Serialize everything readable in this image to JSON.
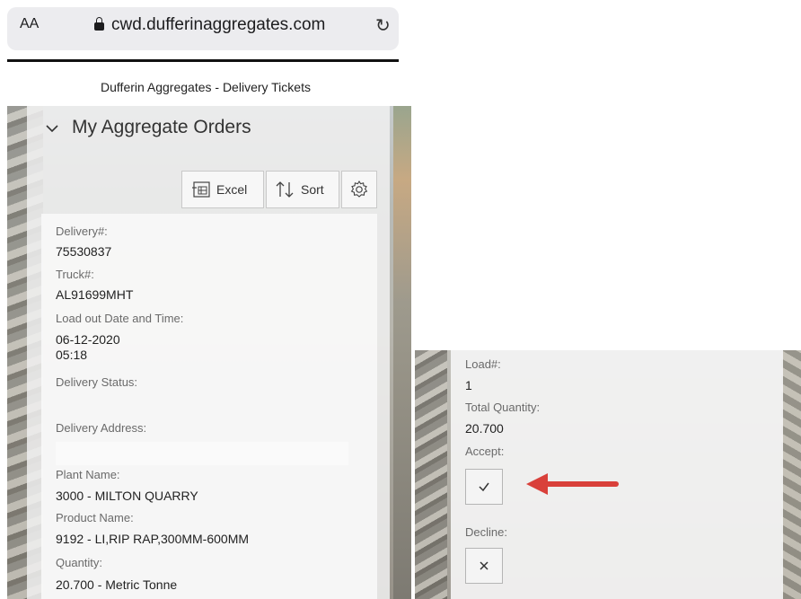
{
  "browser": {
    "text_size_label": "AA",
    "url": "cwd.dufferinaggregates.com",
    "lock_icon": "lock-icon",
    "reload_icon": "reload-icon"
  },
  "app": {
    "title": "Dufferin Aggregates - Delivery Tickets"
  },
  "section": {
    "title": "My Aggregate Orders",
    "collapse_icon": "chevron-down-icon"
  },
  "toolbar": {
    "excel_label": "Excel",
    "sort_label": "Sort",
    "settings_icon": "gear-icon"
  },
  "order": {
    "delivery_label": "Delivery#:",
    "delivery_value": "75530837",
    "truck_label": "Truck#:",
    "truck_value": "AL91699MHT",
    "loadout_label": "Load out Date and Time:",
    "loadout_date": "06-12-2020",
    "loadout_time": "05:18",
    "status_label": "Delivery Status:",
    "status_value": "",
    "address_label": "Delivery Address:",
    "address_value": "",
    "plant_label": "Plant Name:",
    "plant_value": "3000 - MILTON QUARRY",
    "product_label": "Product Name:",
    "product_value": "9192 - LI,RIP RAP,300MM-600MM",
    "quantity_label": "Quantity:",
    "quantity_value": "20.700 - Metric Tonne"
  },
  "detail": {
    "load_label": "Load#:",
    "load_value": "1",
    "total_label": "Total Quantity:",
    "total_value": "20.700",
    "accept_label": "Accept:",
    "accept_icon": "check-icon",
    "decline_label": "Decline:",
    "decline_icon": "close-icon"
  },
  "colors": {
    "annotation_arrow": "#d9403a"
  }
}
